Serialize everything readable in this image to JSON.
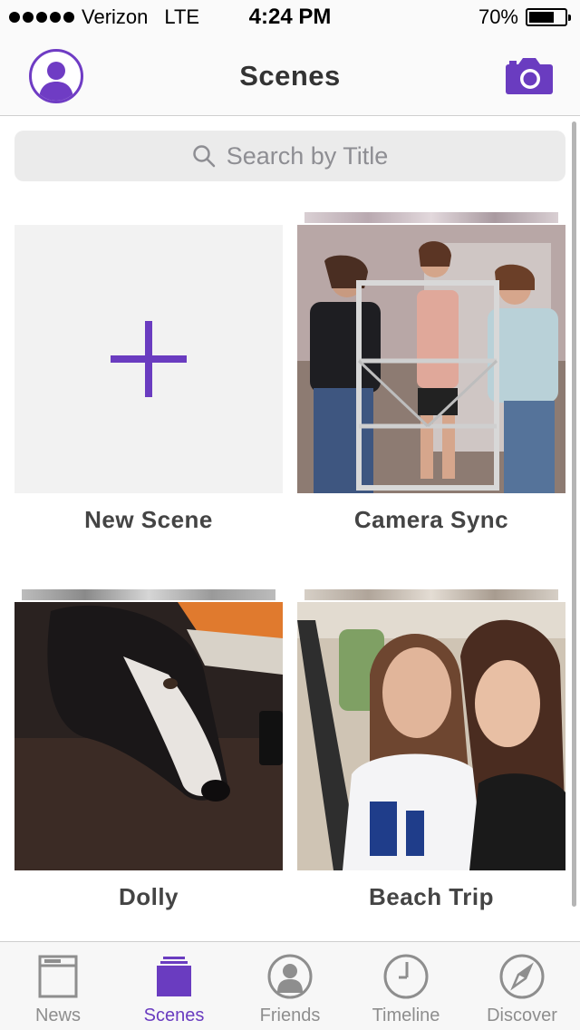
{
  "status_bar": {
    "carrier": "Verizon",
    "network": "LTE",
    "time": "4:24 PM",
    "battery_text": "70%",
    "battery_level": 0.7
  },
  "nav": {
    "title": "Scenes",
    "left_icon": "profile-avatar-icon",
    "right_icon": "camera-icon"
  },
  "search": {
    "placeholder": "Search by Title",
    "icon": "search-icon"
  },
  "scenes": [
    {
      "title": "New Scene",
      "type": "add"
    },
    {
      "title": "Camera Sync",
      "type": "photo"
    },
    {
      "title": "Dolly",
      "type": "photo"
    },
    {
      "title": "Beach Trip",
      "type": "photo"
    }
  ],
  "tabs": [
    {
      "label": "News",
      "icon": "news-icon",
      "active": false
    },
    {
      "label": "Scenes",
      "icon": "scenes-icon",
      "active": true
    },
    {
      "label": "Friends",
      "icon": "friends-icon",
      "active": false
    },
    {
      "label": "Timeline",
      "icon": "timeline-clock-icon",
      "active": false
    },
    {
      "label": "Discover",
      "icon": "discover-compass-icon",
      "active": false
    }
  ],
  "colors": {
    "accent": "#6a3cc0",
    "inactive": "#8e8e8e",
    "tile_bg": "#f2f2f2"
  }
}
